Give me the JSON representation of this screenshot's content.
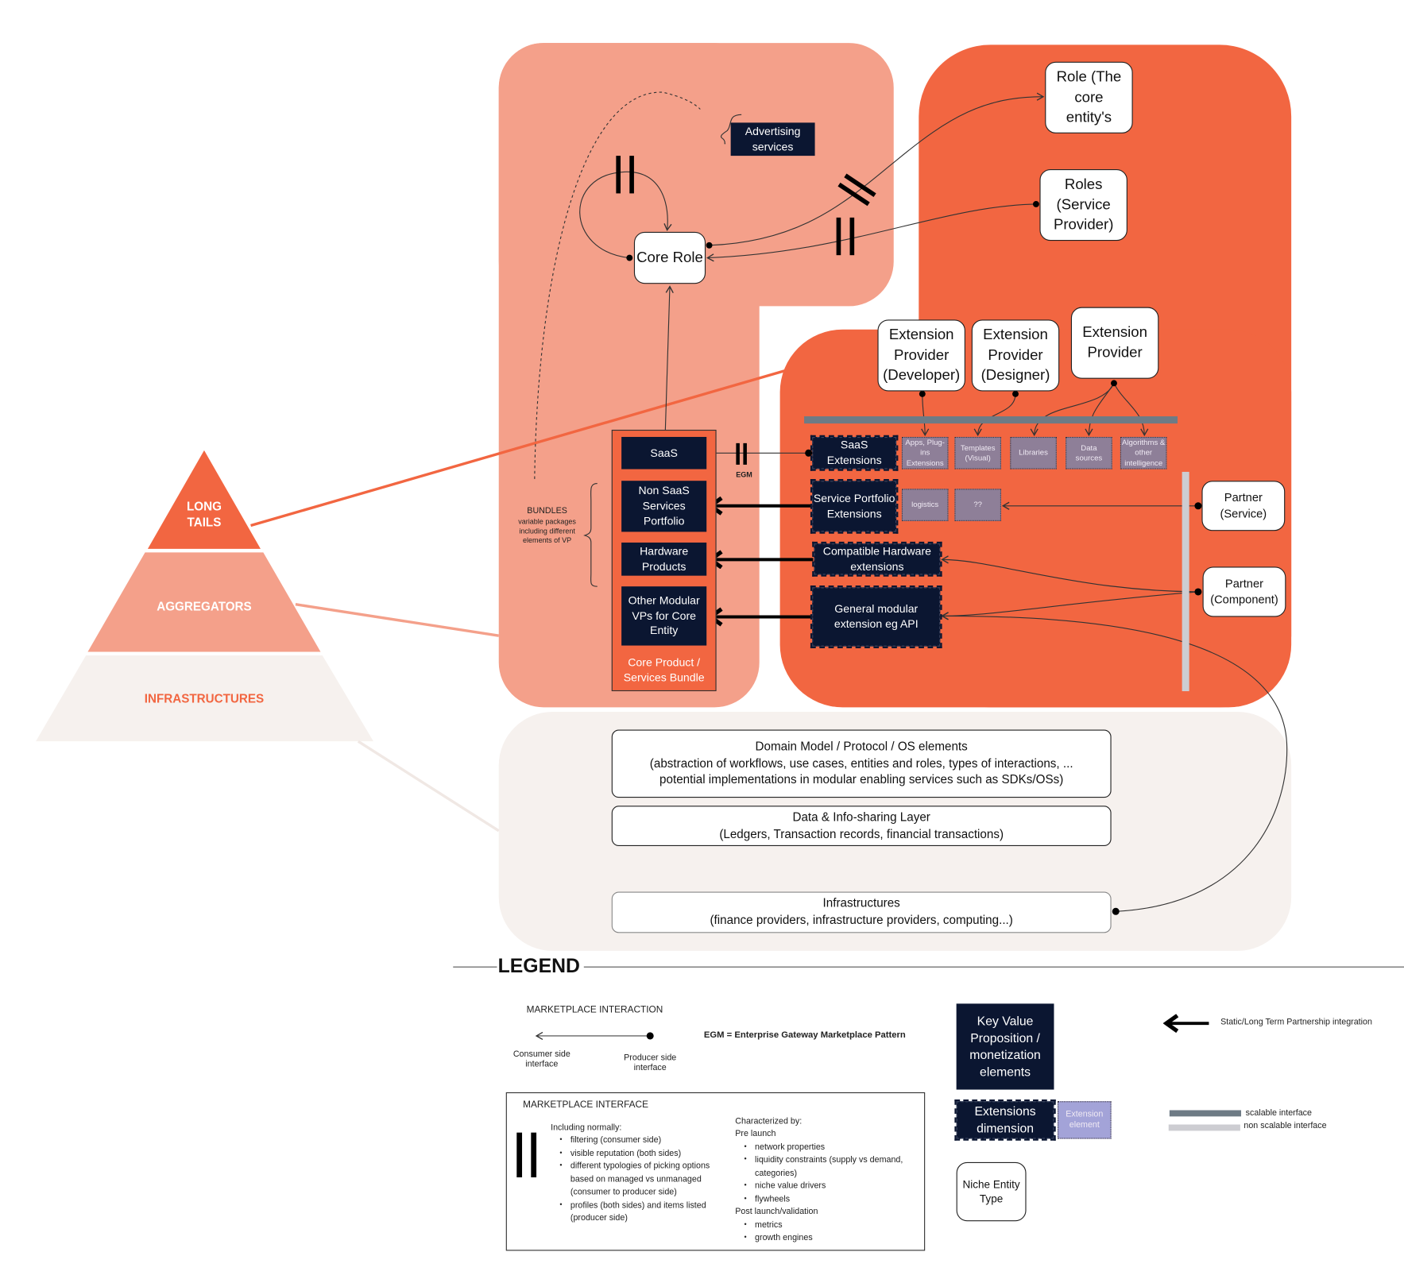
{
  "colors": {
    "aggregators": "#F4A08A",
    "long_tails": "#F26641",
    "infrastructures": "#F6F1EE",
    "key_value": "#0B1631",
    "extension_element": "#8E7F98",
    "legend_extension_element": "#A3A3D8",
    "scalable": "#6E7B85",
    "non_scalable": "#CDCDD2"
  },
  "pyramid": {
    "long_tails": [
      "LONG",
      "TAILS"
    ],
    "aggregators": "AGGREGATORS",
    "infrastructures": "INFRASTRUCTURES"
  },
  "core": {
    "core_role": "Core Role",
    "advertising": "Advertising services",
    "role_core": "Role (The core entity's",
    "roles_sp": "Roles (Service Provider)",
    "bundle_label": "Core Product / Services Bundle",
    "bundle_items": [
      "SaaS",
      "Non SaaS Services Portfolio",
      "Hardware Products",
      "Other Modular VPs for Core Entity"
    ],
    "egm": "EGM",
    "bundles_title": "BUNDLES",
    "bundles_desc": "variable packages including different elements of VP"
  },
  "extensions": {
    "providers": [
      "Extension Provider (Developer)",
      "Extension Provider (Designer)",
      "Extension Provider"
    ],
    "dimensions": [
      "SaaS Extensions",
      "Service Portfolio Extensions",
      "Compatible Hardware extensions",
      "General modular extension eg API"
    ],
    "saas_elements": [
      "Apps, Plug-ins Extensions",
      "Templates (Visual)",
      "Libraries",
      "Data sources",
      "Algorithms & other intelligence"
    ],
    "service_elements": [
      "logistics",
      "??"
    ],
    "partners": [
      "Partner (Service)",
      "Partner (Component)"
    ]
  },
  "layers": {
    "domain_title": "Domain Model / Protocol / OS elements",
    "domain_desc": "(abstraction of workflows, use cases, entities and roles, types of interactions, ... potential implementations in modular enabling services such as SDKs/OSs)",
    "data_title": "Data & Info-sharing Layer",
    "data_desc": "(Ledgers, Transaction records, financial transactions)",
    "infra_title": "Infrastructures",
    "infra_desc": "(finance providers, infrastructure providers, computing...)"
  },
  "legend": {
    "title": "LEGEND",
    "interaction_title": "MARKETPLACE INTERACTION",
    "consumer": "Consumer side interface",
    "producer": "Producer side interface",
    "egm_def": "EGM = Enterprise Gateway Marketplace Pattern",
    "interface_title": "MARKETPLACE INTERFACE",
    "including": "Including normally:",
    "including_items": [
      "filtering (consumer side)",
      "visible reputation (both sides)",
      "different typologies of picking options based on managed vs unmanaged (consumer to producer side)",
      "profiles (both sides) and items listed (producer side)"
    ],
    "characterized": "Characterized by:",
    "pre_launch": "Pre launch",
    "pre_items": [
      "network properties",
      "liquidity constraints (supply vs demand, categories)",
      "niche value drivers",
      "flywheels"
    ],
    "post_launch": "Post launch/validation",
    "post_items": [
      "metrics",
      "growth engines"
    ],
    "key_value": "Key Value Proposition / monetization elements",
    "ext_dimension": "Extensions dimension",
    "ext_element": "Extension element",
    "niche": "Niche Entity Type",
    "static": "Static/Long Term Partnership integration",
    "scalable": "scalable interface",
    "non_scalable": "non scalable interface"
  }
}
